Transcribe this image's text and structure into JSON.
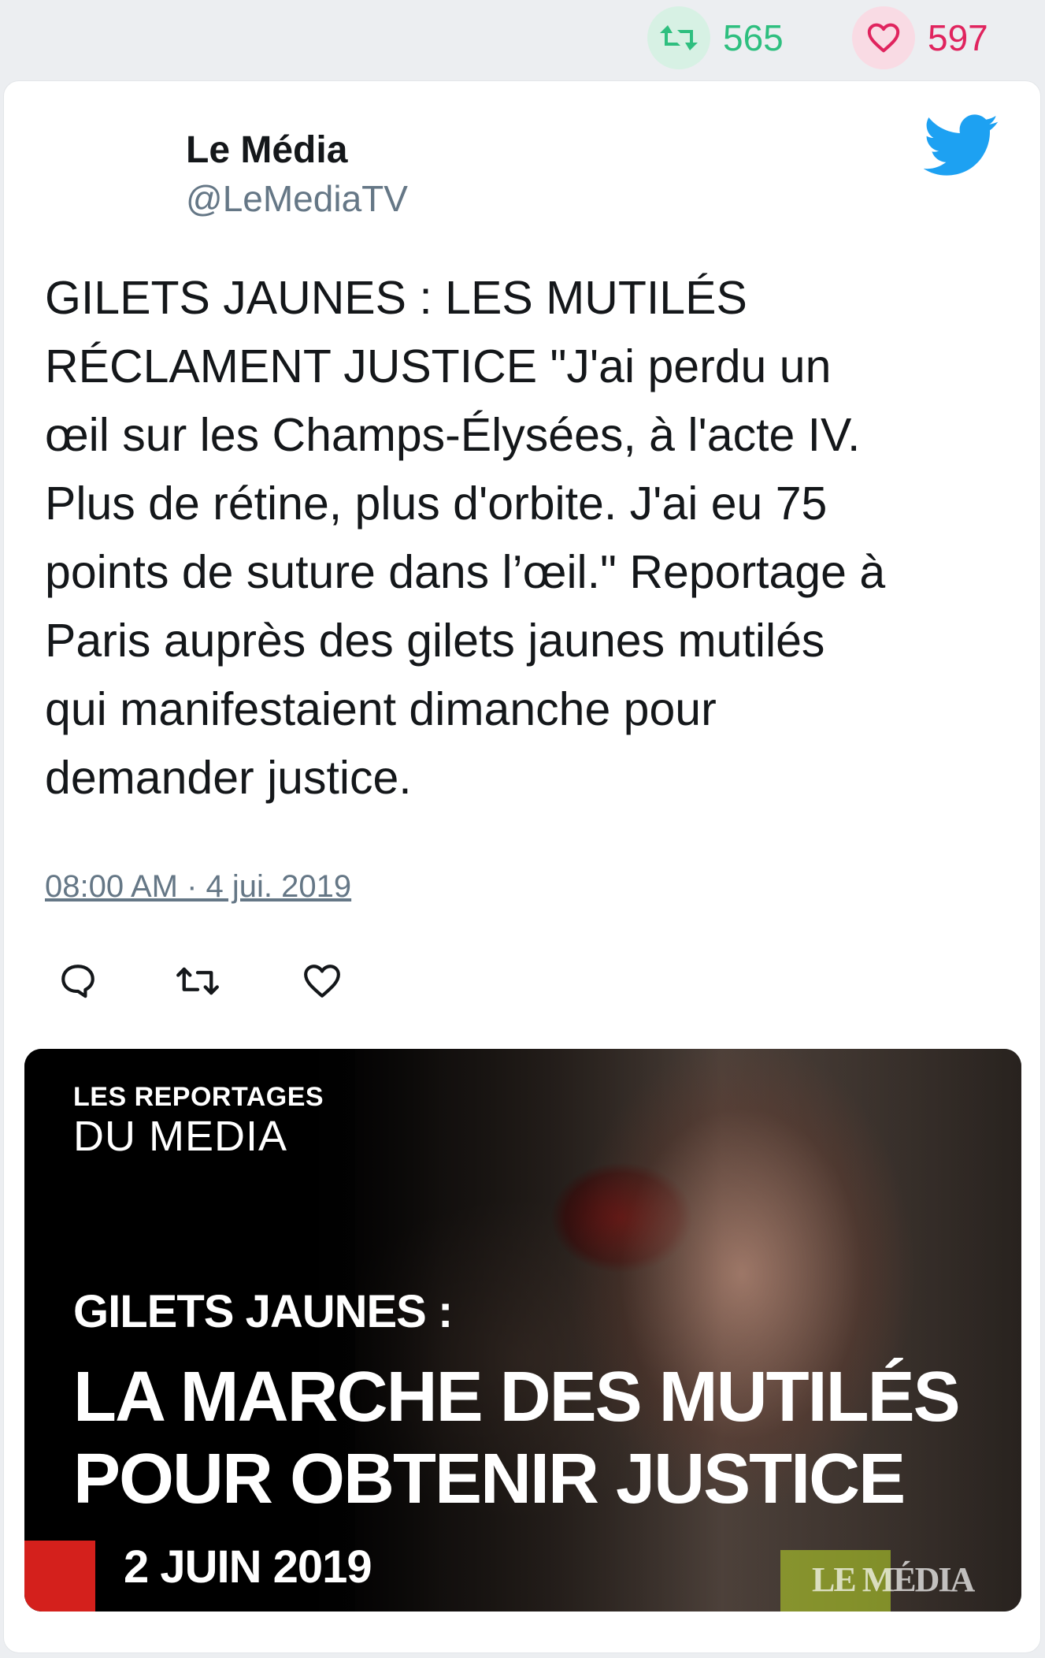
{
  "stats": {
    "retweets": "565",
    "likes": "597",
    "retweet_color": "#2ebf7f",
    "like_color": "#e0245e"
  },
  "tweet": {
    "author_name": "Le Média",
    "author_handle": "@LeMediaTV",
    "text": "GILETS JAUNES : LES MUTILÉS\nRÉCLAMENT JUSTICE \"J'ai perdu un\nœil sur les Champs-Élysées, à l'acte IV.\nPlus de rétine, plus d'orbite. J'ai eu 75\npoints de suture dans l’œil.\" Reportage à\nParis auprès des gilets jaunes mutilés\nqui manifestaient dimanche pour\ndemander justice.",
    "timestamp": "08:00 AM · 4 jui. 2019",
    "brand_icon": "twitter-bird-icon",
    "brand_color": "#1da1f2",
    "actions": [
      "reply-icon",
      "retweet-icon",
      "like-icon"
    ]
  },
  "thumbnail": {
    "series_line1": "LES REPORTAGES",
    "series_line2": "DU MEDIA",
    "kicker": "GILETS JAUNES :",
    "headline": "LA MARCHE DES MUTILÉS\nPOUR OBTENIR JUSTICE",
    "date": "2 JUIN 2019",
    "watermark": "LE MÉDIA",
    "accent_color": "#d4201c"
  }
}
